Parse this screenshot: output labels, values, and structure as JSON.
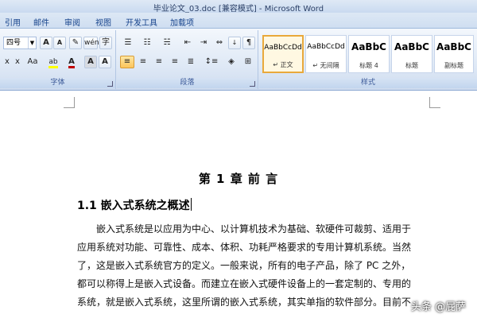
{
  "window": {
    "title": "毕业论文_03.doc [兼容模式] - Microsoft Word"
  },
  "tabs": [
    "引用",
    "邮件",
    "审阅",
    "视图",
    "开发工具",
    "加载项"
  ],
  "ribbon": {
    "font_group": {
      "label": "字体",
      "font_size": "四号",
      "grow_font": "A",
      "shrink_font": "A",
      "superscript": "x",
      "change_case": "Aa",
      "highlight": "ab",
      "font_color": "A",
      "char_shading": "A",
      "char_border": "A"
    },
    "paragraph_group": {
      "label": "段落"
    },
    "styles_group": {
      "label": "样式",
      "styles": [
        {
          "sample": "AaBbCcDd",
          "name": "↵ 正文"
        },
        {
          "sample": "AaBbCcDd",
          "name": "↵ 无间隔"
        },
        {
          "sample": "AaBbC",
          "name": "标题 4"
        },
        {
          "sample": "AaBbC",
          "name": "标题"
        },
        {
          "sample": "AaBbC",
          "name": "副标题"
        }
      ]
    },
    "colors": {
      "highlight": "#ffff00",
      "font_color": "#c00000",
      "accent": "#15428b"
    }
  },
  "document": {
    "chapter_heading": "第 1 章  前  言",
    "section_heading": "1.1  嵌入式系统之概述",
    "paragraph_lines": [
      "　　嵌入式系统是以应用为中心、以计算机技术为基础、软硬件可裁剪、适用于",
      "应用系统对功能、可靠性、成本、体积、功耗严格要求的专用计算机系统。当然",
      "了，这是嵌入式系统官方的定义。一般来说，所有的电子产品，除了 PC 之外，",
      "都可以称得上是嵌入式设备。而建立在嵌入式硬件设备上的一套定制的、专用的",
      "系统，就是嵌入式系统，这里所谓的嵌入式系统，其实单指的软件部分。目前不"
    ]
  },
  "watermark": "头条 @屁萨"
}
